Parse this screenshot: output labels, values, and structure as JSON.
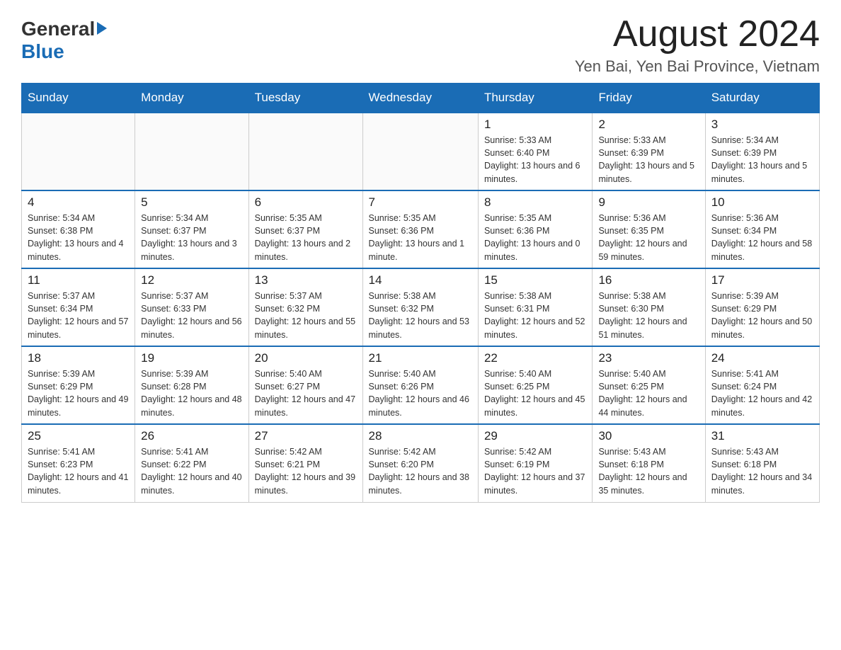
{
  "header": {
    "logo": {
      "general": "General",
      "blue": "Blue"
    },
    "title": "August 2024",
    "subtitle": "Yen Bai, Yen Bai Province, Vietnam"
  },
  "calendar": {
    "days_of_week": [
      "Sunday",
      "Monday",
      "Tuesday",
      "Wednesday",
      "Thursday",
      "Friday",
      "Saturday"
    ],
    "weeks": [
      {
        "days": [
          {
            "number": "",
            "info": ""
          },
          {
            "number": "",
            "info": ""
          },
          {
            "number": "",
            "info": ""
          },
          {
            "number": "",
            "info": ""
          },
          {
            "number": "1",
            "info": "Sunrise: 5:33 AM\nSunset: 6:40 PM\nDaylight: 13 hours and 6 minutes."
          },
          {
            "number": "2",
            "info": "Sunrise: 5:33 AM\nSunset: 6:39 PM\nDaylight: 13 hours and 5 minutes."
          },
          {
            "number": "3",
            "info": "Sunrise: 5:34 AM\nSunset: 6:39 PM\nDaylight: 13 hours and 5 minutes."
          }
        ]
      },
      {
        "days": [
          {
            "number": "4",
            "info": "Sunrise: 5:34 AM\nSunset: 6:38 PM\nDaylight: 13 hours and 4 minutes."
          },
          {
            "number": "5",
            "info": "Sunrise: 5:34 AM\nSunset: 6:37 PM\nDaylight: 13 hours and 3 minutes."
          },
          {
            "number": "6",
            "info": "Sunrise: 5:35 AM\nSunset: 6:37 PM\nDaylight: 13 hours and 2 minutes."
          },
          {
            "number": "7",
            "info": "Sunrise: 5:35 AM\nSunset: 6:36 PM\nDaylight: 13 hours and 1 minute."
          },
          {
            "number": "8",
            "info": "Sunrise: 5:35 AM\nSunset: 6:36 PM\nDaylight: 13 hours and 0 minutes."
          },
          {
            "number": "9",
            "info": "Sunrise: 5:36 AM\nSunset: 6:35 PM\nDaylight: 12 hours and 59 minutes."
          },
          {
            "number": "10",
            "info": "Sunrise: 5:36 AM\nSunset: 6:34 PM\nDaylight: 12 hours and 58 minutes."
          }
        ]
      },
      {
        "days": [
          {
            "number": "11",
            "info": "Sunrise: 5:37 AM\nSunset: 6:34 PM\nDaylight: 12 hours and 57 minutes."
          },
          {
            "number": "12",
            "info": "Sunrise: 5:37 AM\nSunset: 6:33 PM\nDaylight: 12 hours and 56 minutes."
          },
          {
            "number": "13",
            "info": "Sunrise: 5:37 AM\nSunset: 6:32 PM\nDaylight: 12 hours and 55 minutes."
          },
          {
            "number": "14",
            "info": "Sunrise: 5:38 AM\nSunset: 6:32 PM\nDaylight: 12 hours and 53 minutes."
          },
          {
            "number": "15",
            "info": "Sunrise: 5:38 AM\nSunset: 6:31 PM\nDaylight: 12 hours and 52 minutes."
          },
          {
            "number": "16",
            "info": "Sunrise: 5:38 AM\nSunset: 6:30 PM\nDaylight: 12 hours and 51 minutes."
          },
          {
            "number": "17",
            "info": "Sunrise: 5:39 AM\nSunset: 6:29 PM\nDaylight: 12 hours and 50 minutes."
          }
        ]
      },
      {
        "days": [
          {
            "number": "18",
            "info": "Sunrise: 5:39 AM\nSunset: 6:29 PM\nDaylight: 12 hours and 49 minutes."
          },
          {
            "number": "19",
            "info": "Sunrise: 5:39 AM\nSunset: 6:28 PM\nDaylight: 12 hours and 48 minutes."
          },
          {
            "number": "20",
            "info": "Sunrise: 5:40 AM\nSunset: 6:27 PM\nDaylight: 12 hours and 47 minutes."
          },
          {
            "number": "21",
            "info": "Sunrise: 5:40 AM\nSunset: 6:26 PM\nDaylight: 12 hours and 46 minutes."
          },
          {
            "number": "22",
            "info": "Sunrise: 5:40 AM\nSunset: 6:25 PM\nDaylight: 12 hours and 45 minutes."
          },
          {
            "number": "23",
            "info": "Sunrise: 5:40 AM\nSunset: 6:25 PM\nDaylight: 12 hours and 44 minutes."
          },
          {
            "number": "24",
            "info": "Sunrise: 5:41 AM\nSunset: 6:24 PM\nDaylight: 12 hours and 42 minutes."
          }
        ]
      },
      {
        "days": [
          {
            "number": "25",
            "info": "Sunrise: 5:41 AM\nSunset: 6:23 PM\nDaylight: 12 hours and 41 minutes."
          },
          {
            "number": "26",
            "info": "Sunrise: 5:41 AM\nSunset: 6:22 PM\nDaylight: 12 hours and 40 minutes."
          },
          {
            "number": "27",
            "info": "Sunrise: 5:42 AM\nSunset: 6:21 PM\nDaylight: 12 hours and 39 minutes."
          },
          {
            "number": "28",
            "info": "Sunrise: 5:42 AM\nSunset: 6:20 PM\nDaylight: 12 hours and 38 minutes."
          },
          {
            "number": "29",
            "info": "Sunrise: 5:42 AM\nSunset: 6:19 PM\nDaylight: 12 hours and 37 minutes."
          },
          {
            "number": "30",
            "info": "Sunrise: 5:43 AM\nSunset: 6:18 PM\nDaylight: 12 hours and 35 minutes."
          },
          {
            "number": "31",
            "info": "Sunrise: 5:43 AM\nSunset: 6:18 PM\nDaylight: 12 hours and 34 minutes."
          }
        ]
      }
    ]
  }
}
